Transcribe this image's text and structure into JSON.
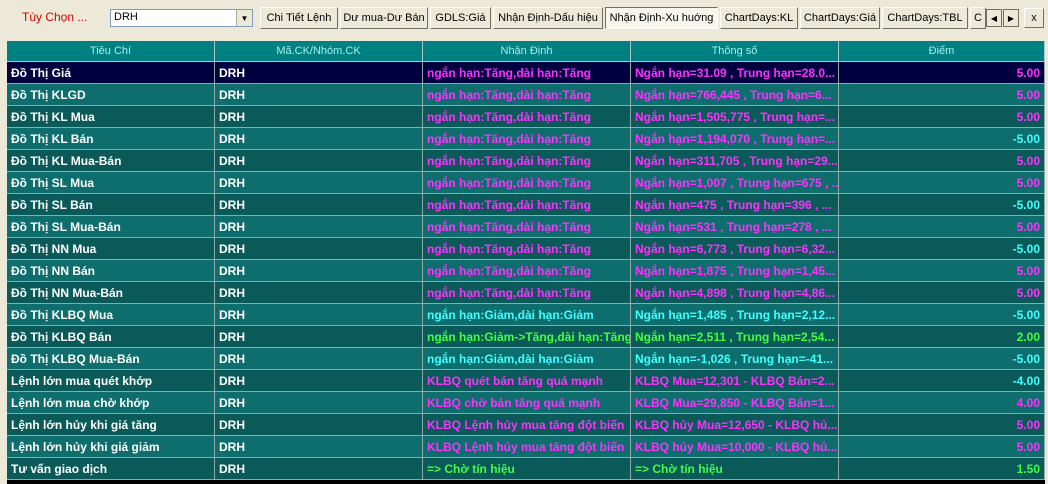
{
  "toolbar": {
    "option_label": "Tùy Chọn ...",
    "symbol_value": "DRH",
    "tabs": [
      {
        "label": "Chi Tiết Lệnh"
      },
      {
        "label": "Dư mua-Dư Bán"
      },
      {
        "label": "GDLS:Giá"
      },
      {
        "label": "Nhận Định-Dấu hiệu"
      },
      {
        "label": "Nhận Định-Xu huớng"
      },
      {
        "label": "ChartDays:KL"
      },
      {
        "label": "ChartDays:Giá"
      },
      {
        "label": "ChartDays:TBL"
      },
      {
        "label": "C"
      }
    ],
    "active_tab": "Nhận Định-Xu huớng",
    "close_label": "x"
  },
  "table": {
    "columns": [
      "Tiêu Chí",
      "Mã.CK/Nhóm.CK",
      "Nhận Định",
      "Thông số",
      "Điểm"
    ],
    "rows": [
      {
        "criteria": "Đồ Thị Giá",
        "code": "DRH",
        "assessment": "ngắn hạn:Tăng,dài hạn:Tăng",
        "params": "Ngắn hạn=31.09 , Trung hạn=28.0...",
        "score": "5.00"
      },
      {
        "criteria": "Đồ Thị KLGD",
        "code": "DRH",
        "assessment": "ngắn hạn:Tăng,dài hạn:Tăng",
        "params": "Ngắn hạn=766,445 , Trung hạn=6...",
        "score": "5.00"
      },
      {
        "criteria": "Đồ Thị KL Mua",
        "code": "DRH",
        "assessment": "ngắn hạn:Tăng,dài hạn:Tăng",
        "params": "Ngắn hạn=1,505,775 , Trung hạn=...",
        "score": "5.00"
      },
      {
        "criteria": "Đồ Thị KL Bán",
        "code": "DRH",
        "assessment": "ngắn hạn:Tăng,dài hạn:Tăng",
        "params": "Ngắn hạn=1,194,070 , Trung hạn=...",
        "score": "-5.00"
      },
      {
        "criteria": "Đồ Thị KL Mua-Bán",
        "code": "DRH",
        "assessment": "ngắn hạn:Tăng,dài hạn:Tăng",
        "params": "Ngắn hạn=311,705 , Trung hạn=29...",
        "score": "5.00"
      },
      {
        "criteria": "Đồ Thị SL Mua",
        "code": "DRH",
        "assessment": "ngắn hạn:Tăng,dài hạn:Tăng",
        "params": "Ngắn hạn=1,007 , Trung hạn=675 , ...",
        "score": "5.00"
      },
      {
        "criteria": "Đồ Thị SL Bán",
        "code": "DRH",
        "assessment": "ngắn hạn:Tăng,dài hạn:Tăng",
        "params": "Ngắn hạn=475 , Trung hạn=396 , ...",
        "score": "-5.00"
      },
      {
        "criteria": "Đồ Thị SL Mua-Bán",
        "code": "DRH",
        "assessment": "ngắn hạn:Tăng,dài hạn:Tăng",
        "params": "Ngắn hạn=531 , Trung hạn=278 , ...",
        "score": "5.00"
      },
      {
        "criteria": "Đồ Thị NN Mua",
        "code": "DRH",
        "assessment": "ngắn hạn:Tăng,dài hạn:Tăng",
        "params": "Ngắn hạn=6,773 , Trung hạn=6,32...",
        "score": "-5.00"
      },
      {
        "criteria": "Đồ Thị NN Bán",
        "code": "DRH",
        "assessment": "ngắn hạn:Tăng,dài hạn:Tăng",
        "params": "Ngắn hạn=1,875 , Trung hạn=1,45...",
        "score": "5.00"
      },
      {
        "criteria": "Đồ Thị NN Mua-Bán",
        "code": "DRH",
        "assessment": "ngắn hạn:Tăng,dài hạn:Tăng",
        "params": "Ngắn hạn=4,898 , Trung hạn=4,86...",
        "score": "5.00"
      },
      {
        "criteria": "Đồ Thị KLBQ Mua",
        "code": "DRH",
        "assessment": "ngắn hạn:Giảm,dài hạn:Giảm",
        "params": "Ngắn hạn=1,485 , Trung hạn=2,12...",
        "score": "-5.00"
      },
      {
        "criteria": "Đồ Thị KLBQ Bán",
        "code": "DRH",
        "assessment": "ngắn hạn:Giảm->Tăng,dài hạn:Tăng",
        "params": "Ngắn hạn=2,511 , Trung hạn=2,54...",
        "score": "2.00"
      },
      {
        "criteria": "Đồ Thị KLBQ Mua-Bán",
        "code": "DRH",
        "assessment": "ngắn hạn:Giảm,dài hạn:Giảm",
        "params": "Ngắn hạn=-1,026 , Trung hạn=-41...",
        "score": "-5.00"
      },
      {
        "criteria": "Lệnh lớn mua quét khớp",
        "code": "DRH",
        "assessment": "KLBQ quét bán tăng quá mạnh",
        "params": "KLBQ Mua=12,301 - KLBQ Bán=2...",
        "score": "-4.00"
      },
      {
        "criteria": "Lệnh lớn mua chờ khớp",
        "code": "DRH",
        "assessment": "KLBQ chờ bán tăng quá mạnh",
        "params": "KLBQ Mua=29,850 - KLBQ Bán=1...",
        "score": "4.00"
      },
      {
        "criteria": "Lệnh lớn hủy khi giá tăng",
        "code": "DRH",
        "assessment": "KLBQ Lệnh hủy mua tăng đột biến",
        "params": "KLBQ hủy Mua=12,650 - KLBQ hủ...",
        "score": "5.00"
      },
      {
        "criteria": "Lệnh lớn hủy khi giá giảm",
        "code": "DRH",
        "assessment": "KLBQ Lệnh hủy mua tăng đột biến",
        "params": "KLBQ hủy Mua=10,000 - KLBQ hủ...",
        "score": "5.00"
      },
      {
        "criteria": "Tư vấn giao dịch",
        "code": "DRH",
        "assessment": "=> Chờ tín hiệu",
        "params": "=> Chờ tín hiệu",
        "score": "1.50"
      }
    ]
  },
  "colors": {
    "magenta": "#ff30ff",
    "cyan": "#40ffff",
    "green": "#40ff40",
    "yellow": "#ffff40",
    "row_dark": "#0a5a5a",
    "row_teal": "#0e6e6e",
    "row_selected": "#000040"
  }
}
